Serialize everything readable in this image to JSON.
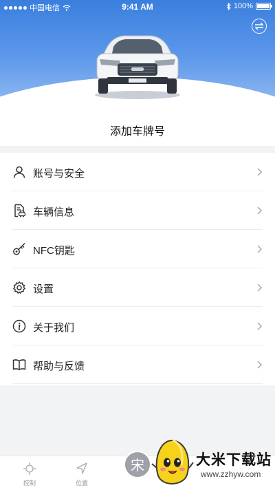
{
  "status_bar": {
    "carrier": "中国电信",
    "time": "9:41 AM",
    "battery": "100%"
  },
  "header": {
    "title": "添加车牌号",
    "colors": {
      "sky_top": "#3a7fde",
      "sky_bottom": "#8fb8f1"
    }
  },
  "menu": {
    "items": [
      {
        "label": "账号与安全",
        "icon": "user-icon"
      },
      {
        "label": "车辆信息",
        "icon": "car-document-icon"
      },
      {
        "label": "NFC钥匙",
        "icon": "key-icon"
      },
      {
        "label": "设置",
        "icon": "gear-icon"
      },
      {
        "label": "关于我们",
        "icon": "info-icon"
      },
      {
        "label": "帮助与反馈",
        "icon": "book-icon"
      }
    ]
  },
  "tabbar": {
    "tabs": [
      {
        "label": "控制",
        "icon": "control-icon"
      },
      {
        "label": "位置",
        "icon": "location-arrow-icon"
      }
    ],
    "center_label": "宋"
  },
  "watermark": {
    "title": "大米下载站",
    "url": "www.zzhyw.com"
  }
}
